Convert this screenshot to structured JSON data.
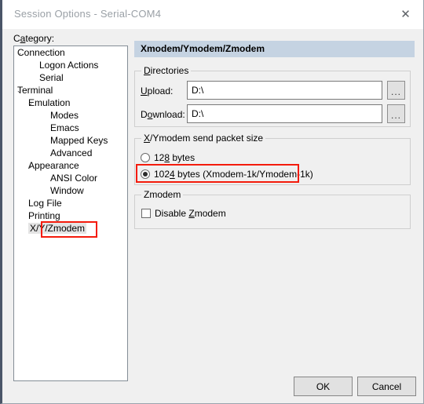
{
  "window": {
    "title": "Session Options - Serial-COM4",
    "close_icon": "close-icon"
  },
  "sidebar": {
    "category_label_pre": "C",
    "category_label_accel": "a",
    "category_label_post": "tegory:",
    "items": [
      {
        "label": "Connection",
        "indent": 0,
        "chevron": "⌄",
        "selected": false
      },
      {
        "label": "Logon Actions",
        "indent": 2,
        "chevron": "",
        "selected": false
      },
      {
        "label": "Serial",
        "indent": 2,
        "chevron": "",
        "selected": false
      },
      {
        "label": "Terminal",
        "indent": 0,
        "chevron": "⌄",
        "selected": false
      },
      {
        "label": "Emulation",
        "indent": 1,
        "chevron": "⌄",
        "selected": false
      },
      {
        "label": "Modes",
        "indent": 3,
        "chevron": "",
        "selected": false
      },
      {
        "label": "Emacs",
        "indent": 3,
        "chevron": "",
        "selected": false
      },
      {
        "label": "Mapped Keys",
        "indent": 3,
        "chevron": "",
        "selected": false
      },
      {
        "label": "Advanced",
        "indent": 3,
        "chevron": "",
        "selected": false
      },
      {
        "label": "Appearance",
        "indent": 1,
        "chevron": "⌄",
        "selected": false
      },
      {
        "label": "ANSI Color",
        "indent": 3,
        "chevron": "",
        "selected": false
      },
      {
        "label": "Window",
        "indent": 3,
        "chevron": "",
        "selected": false
      },
      {
        "label": "Log File",
        "indent": 1,
        "chevron": "",
        "selected": false
      },
      {
        "label": "Printing",
        "indent": 1,
        "chevron": "",
        "selected": false
      },
      {
        "label": "X/Y/Zmodem",
        "indent": 1,
        "chevron": "",
        "selected": true
      }
    ]
  },
  "main": {
    "header": "Xmodem/Ymodem/Zmodem",
    "directories": {
      "legend_pre": "",
      "legend_accel": "D",
      "legend_post": "irectories",
      "upload": {
        "label_pre": "",
        "label_accel": "U",
        "label_post": "pload:",
        "value": "D:\\",
        "browse_label": "..."
      },
      "download": {
        "label_pre": "D",
        "label_accel": "o",
        "label_post": "wnload:",
        "value": "D:\\",
        "browse_label": "..."
      }
    },
    "packet_size": {
      "legend_pre": "",
      "legend_accel": "X",
      "legend_post": "/Ymodem send packet size",
      "options": [
        {
          "pre": "12",
          "accel": "8",
          "post": " bytes",
          "selected": false
        },
        {
          "pre": "102",
          "accel": "4",
          "post": " bytes  (Xmodem-1k/Ymodem-1k)",
          "selected": true
        }
      ]
    },
    "zmodem": {
      "legend": "Zmodem",
      "checkbox": {
        "pre": "Disable ",
        "accel": "Z",
        "post": "modem",
        "checked": false
      }
    }
  },
  "footer": {
    "ok_label": "OK",
    "cancel_label": "Cancel"
  },
  "annotations": {
    "highlight_color": "#f41b0c"
  }
}
